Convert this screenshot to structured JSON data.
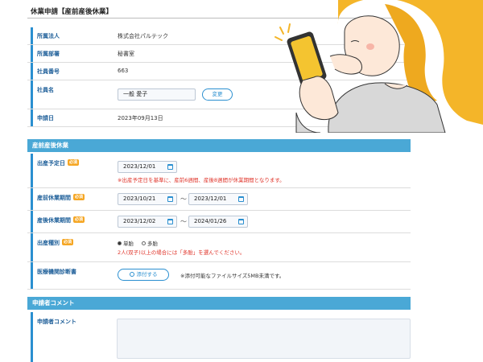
{
  "page": {
    "title": "休業申請【産前産後休業】"
  },
  "info": {
    "company_label": "所属法人",
    "company_value": "株式会社パルテック",
    "dept_label": "所属部署",
    "dept_value": "秘書室",
    "emp_no_label": "社員番号",
    "emp_no_value": "663",
    "emp_name_label": "社員名",
    "emp_name_value": "一般 愛子",
    "change_button": "変更",
    "apply_date_label": "申請日",
    "apply_date_value": "2023年09月13日"
  },
  "maternity": {
    "section_title": "産前産後休業",
    "required_badge": "必須",
    "due_label": "出産予定日",
    "due_value": "2023/12/01",
    "due_note": "※出産予定日を基準に、産前6週間、産後8週間が休業期間となります。",
    "prenatal_label": "産前休業期間",
    "prenatal_from": "2023/10/21",
    "prenatal_to": "2023/12/01",
    "postnatal_label": "産後休業期間",
    "postnatal_from": "2023/12/02",
    "postnatal_to": "2024/01/26",
    "range_sep": "～",
    "birth_type_label": "出産種別",
    "single": "単胎",
    "multiple": "多胎",
    "birth_type_note": "2人(双子)以上の場合には「多胎」を選んでください。",
    "medical_doc_label": "医療機関診断書",
    "attach_button": "添付する",
    "attach_note": "※添付可能なファイルサイズ5MB未満です。"
  },
  "comment": {
    "section_title": "申請者コメント",
    "label": "申請者コメント",
    "value": ""
  },
  "colors": {
    "accent": "#2a8fd0",
    "section": "#4aa8d6",
    "required": "#f5a623",
    "warning": "#e0352b"
  }
}
